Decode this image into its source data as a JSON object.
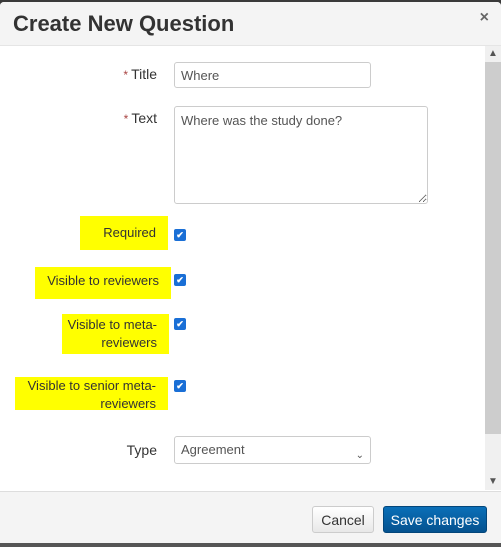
{
  "modal": {
    "title": "Create New Question",
    "close_icon": "×"
  },
  "form": {
    "title": {
      "label": "Title",
      "required_mark": "*",
      "value": "Where"
    },
    "text": {
      "label": "Text",
      "required_mark": "*",
      "value": "Where was the study done?"
    },
    "checkboxes": [
      {
        "label": "Required",
        "checked": true
      },
      {
        "label": "Visible to reviewers",
        "checked": true
      },
      {
        "label_line1": "Visible to meta-",
        "label_line2": "reviewers",
        "checked": true
      },
      {
        "label_line1": "Visible to senior meta-",
        "label_line2": "reviewers",
        "checked": true
      }
    ],
    "type": {
      "label": "Type",
      "value": "Agreement"
    }
  },
  "icons": {
    "check": "✔",
    "chevron_down": "⌄",
    "scroll_up": "▲",
    "scroll_down": "▼"
  },
  "footer": {
    "cancel_label": "Cancel",
    "save_label": "Save changes"
  },
  "colors": {
    "highlight": "#ffff00",
    "primary": "#05528f",
    "checkbox": "#1a6fd6",
    "required": "#a94442"
  }
}
